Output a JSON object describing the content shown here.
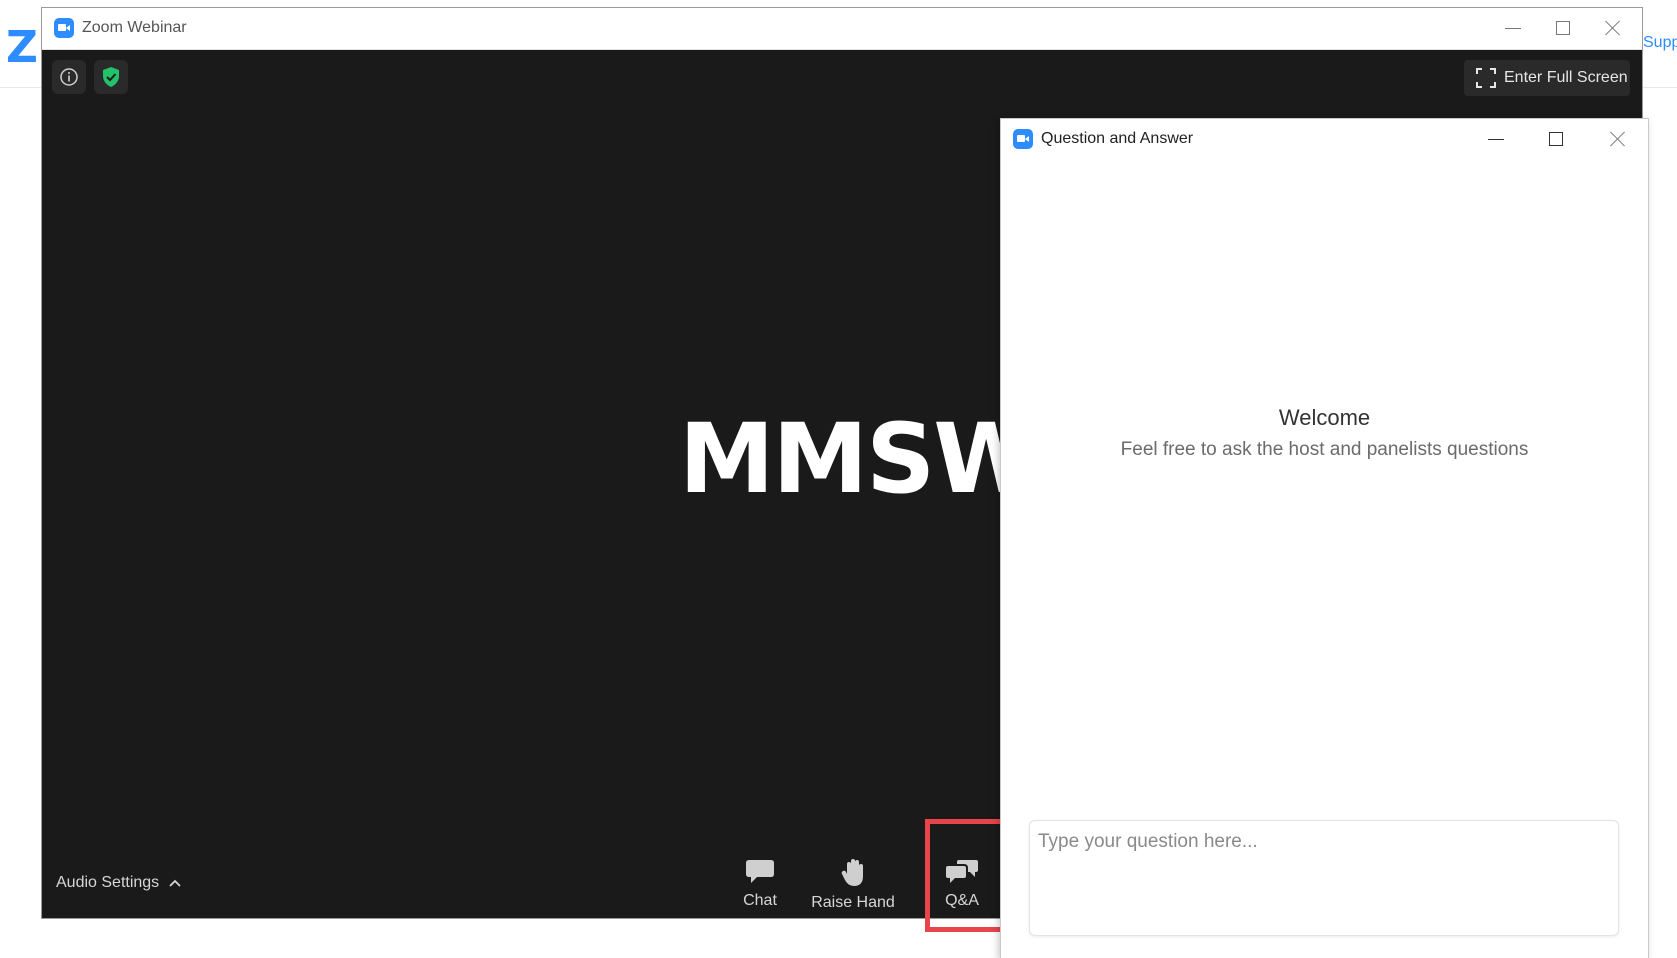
{
  "background": {
    "logo_text": "zoom",
    "support_link": "Supp"
  },
  "main_window": {
    "title": "Zoom Webinar",
    "fullscreen_label": "Enter Full Screen",
    "shared_content_text": "MMSW",
    "audio_settings_label": "Audio Settings",
    "toolbar": {
      "chat_label": "Chat",
      "raise_hand_label": "Raise Hand",
      "qa_label": "Q&A"
    }
  },
  "qa_window": {
    "title": "Question and Answer",
    "welcome_heading": "Welcome",
    "welcome_subtitle": "Feel free to ask the host and panelists questions",
    "input_placeholder": "Type your question here..."
  },
  "colors": {
    "zoom_blue": "#2D8CFF",
    "video_bg": "#1a1a1a",
    "security_green": "#23C26A",
    "highlight_red": "#e8454a"
  }
}
